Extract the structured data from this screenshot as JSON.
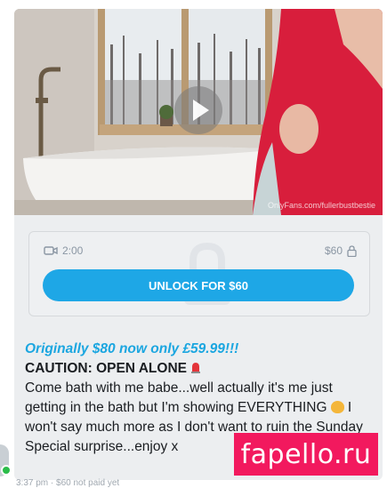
{
  "media": {
    "watermark": "OnlyFans.com/fullerbustbestie"
  },
  "lock": {
    "duration": "2:00",
    "price": "$60",
    "unlock_label": "UNLOCK FOR $60"
  },
  "post": {
    "promo_line": "Originally $80 now only £59.99!!!",
    "caution_line": "CAUTION: OPEN ALONE",
    "body_part1": "Come bath with me babe...well actually it's me just getting in the bath but I'm showing EVERYTHING",
    "body_part2": " I won't say much more as I don't want to ruin the Sunday Special surprise...enjoy x"
  },
  "meta": {
    "time_price": "3:37 pm · $60 not paid yet"
  },
  "banner": {
    "text": "fapello.ru"
  },
  "colors": {
    "accent": "#1ea7e6",
    "promo": "#1ba6e0",
    "banner": "#f2195e"
  }
}
